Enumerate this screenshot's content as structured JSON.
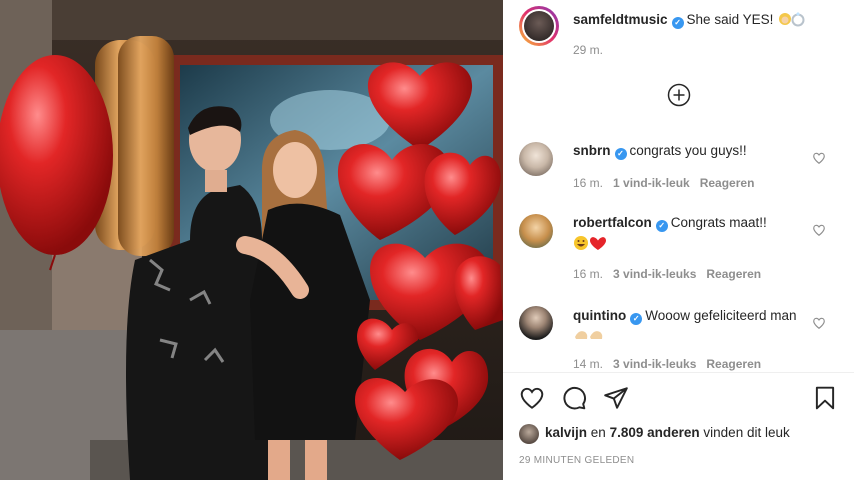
{
  "post": {
    "author": "samfeldtmusic",
    "caption": "She said YES!",
    "caption_emoji": "bride-ring-emoji",
    "time": "29 m.",
    "add_comment_icon": "plus-circle-icon"
  },
  "comments": [
    {
      "user": "snbrn",
      "text": "congrats you guys!!",
      "time": "16 m.",
      "likes": "1 vind-ik-leuk",
      "reply": "Reageren"
    },
    {
      "user": "robertfalcon",
      "text": "Congrats maat!!",
      "emoji": "grinning-sweat-emoji red-heart-emoji",
      "time": "16 m.",
      "likes": "3 vind-ik-leuks",
      "reply": "Reageren"
    },
    {
      "user": "quintino",
      "text": "Wooow gefeliciteerd man",
      "emoji": "flexed-biceps-emoji",
      "time": "14 m.",
      "likes": "3 vind-ik-leuks",
      "reply": "Reageren"
    }
  ],
  "actions": {
    "icons": [
      "heart-icon",
      "comment-icon",
      "share-icon",
      "bookmark-icon"
    ]
  },
  "likes": {
    "first_user": "kalvijn",
    "connector": "en",
    "count_text": "7.809 anderen",
    "suffix": "vinden dit leuk"
  },
  "timestamp": "29 MINUTEN GELEDEN",
  "colors": {
    "verified": "#3897f0",
    "text": "#262626",
    "muted": "#8e8e8e",
    "balloon_red": "#d11a1a",
    "balloon_gold": "#c98a3c"
  }
}
